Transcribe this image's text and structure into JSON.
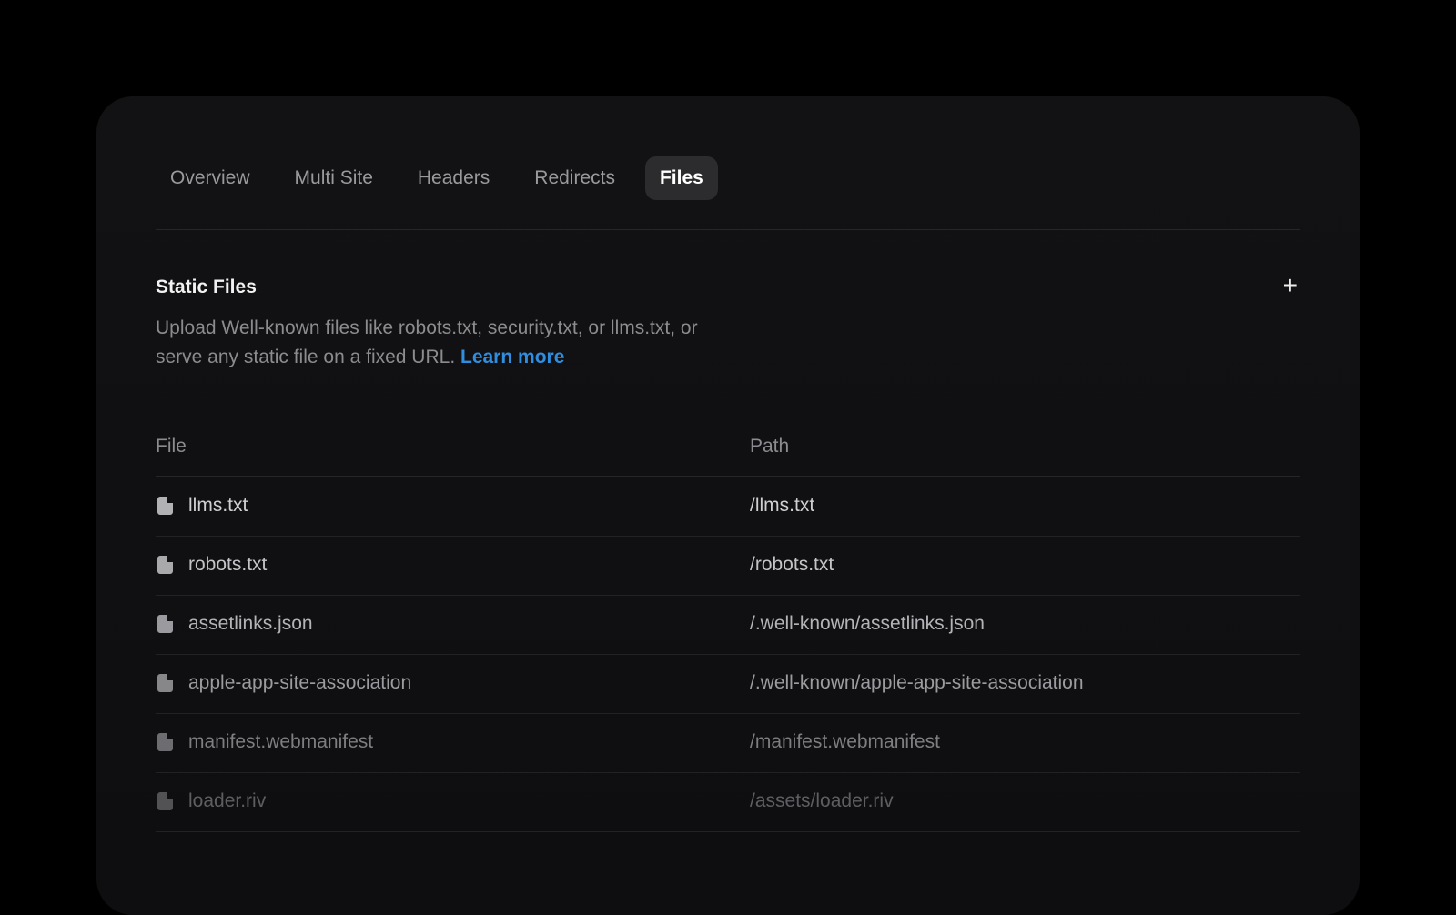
{
  "tabs": [
    {
      "label": "Overview"
    },
    {
      "label": "Multi Site"
    },
    {
      "label": "Headers"
    },
    {
      "label": "Redirects"
    },
    {
      "label": "Files",
      "active": true
    }
  ],
  "section": {
    "title": "Static Files",
    "description": "Upload Well-known files like robots.txt, security.txt, or llms.txt, or serve any static file on a fixed URL.",
    "learn_more": "Learn more",
    "add_icon": "plus-icon"
  },
  "table": {
    "columns": [
      "File",
      "Path"
    ],
    "rows": [
      {
        "file": "llms.txt",
        "path": "/llms.txt"
      },
      {
        "file": "robots.txt",
        "path": "/robots.txt"
      },
      {
        "file": "assetlinks.json",
        "path": "/.well-known/assetlinks.json"
      },
      {
        "file": "apple-app-site-association",
        "path": "/.well-known/apple-app-site-association"
      },
      {
        "file": "manifest.webmanifest",
        "path": "/manifest.webmanifest"
      },
      {
        "file": "loader.riv",
        "path": "/assets/loader.riv"
      }
    ]
  },
  "colors": {
    "accent": "#2f8ee0",
    "background": "#000000",
    "card": "#121214"
  }
}
